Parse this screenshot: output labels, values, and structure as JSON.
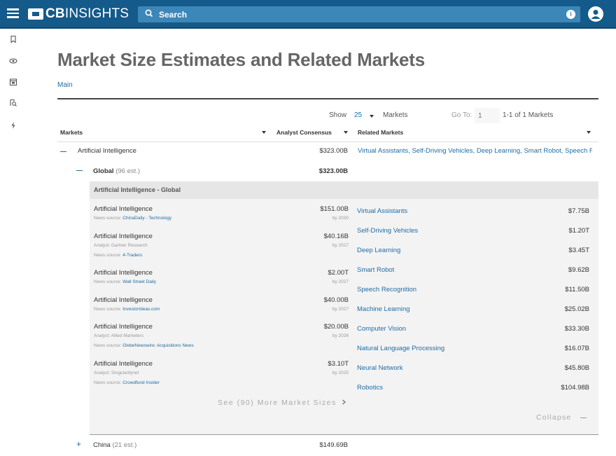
{
  "app": {
    "logo_bold": "CB",
    "logo_light": "INSIGHTS"
  },
  "search": {
    "placeholder": "Search"
  },
  "page": {
    "title": "Market Size Estimates and Related Markets",
    "tab": "Main"
  },
  "controls": {
    "show_label": "Show",
    "show_value": "25",
    "markets_label": "Markets",
    "goto_label": "Go To:",
    "goto_value": "1",
    "pagination": "1-1 of 1 Markets"
  },
  "columns": {
    "markets": "Markets",
    "consensus": "Analyst Consensus",
    "related": "Related Markets"
  },
  "top_row": {
    "name": "Artificial Intelligence",
    "value": "$323.00B",
    "related": "Virtual Assistants, Self-Driving Vehicles, Deep Learning, Smart Robot, Speech R..."
  },
  "global_row": {
    "name": "Global",
    "count": "(96 est.)",
    "value": "$323.00B"
  },
  "panel_header": "Artificial Intelligence - Global",
  "estimates": [
    {
      "title": "Artificial Intelligence",
      "value": "$151.00B",
      "by": "by 2030",
      "analyst": "",
      "source_label": "News source:",
      "source": "ChinaDaily - Technology"
    },
    {
      "title": "Artificial Intelligence",
      "value": "$40.16B",
      "by": "by 2027",
      "analyst": "Analyst: Gartner Research",
      "source_label": "News source:",
      "source": "4-Traders"
    },
    {
      "title": "Artificial Intelligence",
      "value": "$2.00T",
      "by": "by 2027",
      "analyst": "",
      "source_label": "News source:",
      "source": "Wall Street Daily"
    },
    {
      "title": "Artificial Intelligence",
      "value": "$40.00B",
      "by": "by 2027",
      "analyst": "",
      "source_label": "News source:",
      "source": "InvestorIdeas.com"
    },
    {
      "title": "Artificial Intelligence",
      "value": "$20.00B",
      "by": "by 2026",
      "analyst": "Analyst: Allied Marketers",
      "source_label": "News source:",
      "source": "GlobeNewswire: Acquisitions News"
    },
    {
      "title": "Artificial Intelligence",
      "value": "$3.10T",
      "by": "by 2025",
      "analyst": "Analyst: Singularitynet",
      "source_label": "News source:",
      "source": "Crowdfund Insider"
    }
  ],
  "related_markets": [
    {
      "name": "Virtual Assistants",
      "value": "$7.75B"
    },
    {
      "name": "Self-Driving Vehicles",
      "value": "$1.20T"
    },
    {
      "name": "Deep Learning",
      "value": "$3.45T"
    },
    {
      "name": "Smart Robot",
      "value": "$9.62B"
    },
    {
      "name": "Speech Recognition",
      "value": "$11.50B"
    },
    {
      "name": "Machine Learning",
      "value": "$25.02B"
    },
    {
      "name": "Computer Vision",
      "value": "$33.30B"
    },
    {
      "name": "Natural Language Processing",
      "value": "$16.07B"
    },
    {
      "name": "Neural Network",
      "value": "$45.80B"
    },
    {
      "name": "Robotics",
      "value": "$104.98B"
    }
  ],
  "see_more": "See (90) More Market Sizes",
  "collapse": "Collapse",
  "china_row": {
    "name": "China",
    "count": "(21 est.)",
    "value": "$149.69B"
  },
  "colors": {
    "brand": "#145a8a",
    "link": "#1e6ca6"
  }
}
